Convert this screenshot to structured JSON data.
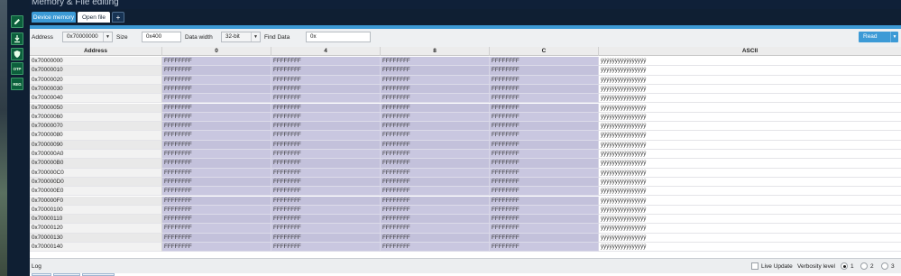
{
  "window": {
    "title": "Memory & File editing"
  },
  "sidebar": {
    "items": [
      {
        "icon": "edit-icon",
        "label": ""
      },
      {
        "icon": "download-icon",
        "label": ""
      },
      {
        "icon": "shield-icon",
        "label": ""
      },
      {
        "icon": "otp-icon",
        "label": "OTP"
      },
      {
        "icon": "register-icon",
        "label": "REG"
      }
    ]
  },
  "tabs": [
    {
      "label": "Device memory",
      "active": true
    },
    {
      "label": "Open file",
      "active": false
    },
    {
      "label": "+",
      "active": false
    }
  ],
  "toolbar": {
    "address_label": "Address",
    "address_value": "0x70000000",
    "size_label": "Size",
    "size_value": "0x400",
    "width_label": "Data width",
    "width_value": "32-bit",
    "find_label": "Find Data",
    "find_value": "0x",
    "read_label": "Read"
  },
  "table": {
    "headers": [
      "Address",
      "0",
      "4",
      "8",
      "C",
      "ASCII"
    ],
    "rows": [
      {
        "address": "0x70000000",
        "cells": [
          "FFFFFFFF",
          "FFFFFFFF",
          "FFFFFFFF",
          "FFFFFFFF"
        ],
        "ascii": "ÿÿÿÿÿÿÿÿÿÿÿÿÿÿÿÿ"
      },
      {
        "address": "0x70000010",
        "cells": [
          "FFFFFFFF",
          "FFFFFFFF",
          "FFFFFFFF",
          "FFFFFFFF"
        ],
        "ascii": "ÿÿÿÿÿÿÿÿÿÿÿÿÿÿÿÿ"
      },
      {
        "address": "0x70000020",
        "cells": [
          "FFFFFFFF",
          "FFFFFFFF",
          "FFFFFFFF",
          "FFFFFFFF"
        ],
        "ascii": "ÿÿÿÿÿÿÿÿÿÿÿÿÿÿÿÿ"
      },
      {
        "address": "0x70000030",
        "cells": [
          "FFFFFFFF",
          "FFFFFFFF",
          "FFFFFFFF",
          "FFFFFFFF"
        ],
        "ascii": "ÿÿÿÿÿÿÿÿÿÿÿÿÿÿÿÿ"
      },
      {
        "address": "0x70000040",
        "cells": [
          "FFFFFFFF",
          "FFFFFFFF",
          "FFFFFFFF",
          "FFFFFFFF"
        ],
        "ascii": "ÿÿÿÿÿÿÿÿÿÿÿÿÿÿÿÿ"
      },
      {
        "address": "0x70000050",
        "cells": [
          "FFFFFFFF",
          "FFFFFFFF",
          "FFFFFFFF",
          "FFFFFFFF"
        ],
        "ascii": "ÿÿÿÿÿÿÿÿÿÿÿÿÿÿÿÿ"
      },
      {
        "address": "0x70000060",
        "cells": [
          "FFFFFFFF",
          "FFFFFFFF",
          "FFFFFFFF",
          "FFFFFFFF"
        ],
        "ascii": "ÿÿÿÿÿÿÿÿÿÿÿÿÿÿÿÿ"
      },
      {
        "address": "0x70000070",
        "cells": [
          "FFFFFFFF",
          "FFFFFFFF",
          "FFFFFFFF",
          "FFFFFFFF"
        ],
        "ascii": "ÿÿÿÿÿÿÿÿÿÿÿÿÿÿÿÿ"
      },
      {
        "address": "0x70000080",
        "cells": [
          "FFFFFFFF",
          "FFFFFFFF",
          "FFFFFFFF",
          "FFFFFFFF"
        ],
        "ascii": "ÿÿÿÿÿÿÿÿÿÿÿÿÿÿÿÿ"
      },
      {
        "address": "0x70000090",
        "cells": [
          "FFFFFFFF",
          "FFFFFFFF",
          "FFFFFFFF",
          "FFFFFFFF"
        ],
        "ascii": "ÿÿÿÿÿÿÿÿÿÿÿÿÿÿÿÿ"
      },
      {
        "address": "0x700000A0",
        "cells": [
          "FFFFFFFF",
          "FFFFFFFF",
          "FFFFFFFF",
          "FFFFFFFF"
        ],
        "ascii": "ÿÿÿÿÿÿÿÿÿÿÿÿÿÿÿÿ"
      },
      {
        "address": "0x700000B0",
        "cells": [
          "FFFFFFFF",
          "FFFFFFFF",
          "FFFFFFFF",
          "FFFFFFFF"
        ],
        "ascii": "ÿÿÿÿÿÿÿÿÿÿÿÿÿÿÿÿ"
      },
      {
        "address": "0x700000C0",
        "cells": [
          "FFFFFFFF",
          "FFFFFFFF",
          "FFFFFFFF",
          "FFFFFFFF"
        ],
        "ascii": "ÿÿÿÿÿÿÿÿÿÿÿÿÿÿÿÿ"
      },
      {
        "address": "0x700000D0",
        "cells": [
          "FFFFFFFF",
          "FFFFFFFF",
          "FFFFFFFF",
          "FFFFFFFF"
        ],
        "ascii": "ÿÿÿÿÿÿÿÿÿÿÿÿÿÿÿÿ"
      },
      {
        "address": "0x700000E0",
        "cells": [
          "FFFFFFFF",
          "FFFFFFFF",
          "FFFFFFFF",
          "FFFFFFFF"
        ],
        "ascii": "ÿÿÿÿÿÿÿÿÿÿÿÿÿÿÿÿ"
      },
      {
        "address": "0x700000F0",
        "cells": [
          "FFFFFFFF",
          "FFFFFFFF",
          "FFFFFFFF",
          "FFFFFFFF"
        ],
        "ascii": "ÿÿÿÿÿÿÿÿÿÿÿÿÿÿÿÿ"
      },
      {
        "address": "0x70000100",
        "cells": [
          "FFFFFFFF",
          "FFFFFFFF",
          "FFFFFFFF",
          "FFFFFFFF"
        ],
        "ascii": "ÿÿÿÿÿÿÿÿÿÿÿÿÿÿÿÿ"
      },
      {
        "address": "0x70000110",
        "cells": [
          "FFFFFFFF",
          "FFFFFFFF",
          "FFFFFFFF",
          "FFFFFFFF"
        ],
        "ascii": "ÿÿÿÿÿÿÿÿÿÿÿÿÿÿÿÿ"
      },
      {
        "address": "0x70000120",
        "cells": [
          "FFFFFFFF",
          "FFFFFFFF",
          "FFFFFFFF",
          "FFFFFFFF"
        ],
        "ascii": "ÿÿÿÿÿÿÿÿÿÿÿÿÿÿÿÿ"
      },
      {
        "address": "0x70000130",
        "cells": [
          "FFFFFFFF",
          "FFFFFFFF",
          "FFFFFFFF",
          "FFFFFFFF"
        ],
        "ascii": "ÿÿÿÿÿÿÿÿÿÿÿÿÿÿÿÿ"
      },
      {
        "address": "0x70000140",
        "cells": [
          "FFFFFFFF",
          "FFFFFFFF",
          "FFFFFFFF",
          "FFFFFFFF"
        ],
        "ascii": "ÿÿÿÿÿÿÿÿÿÿÿÿÿÿÿÿ"
      }
    ]
  },
  "logbar": {
    "log_label": "Log",
    "live_update_label": "Live Update",
    "verbosity_label": "Verbosity level",
    "levels": [
      "1",
      "2",
      "3"
    ],
    "selected_level": "1"
  },
  "colors": {
    "accent": "#3c9ad6",
    "sidebar": "#0f1f33",
    "hex_cell": "#c9c7e0"
  }
}
